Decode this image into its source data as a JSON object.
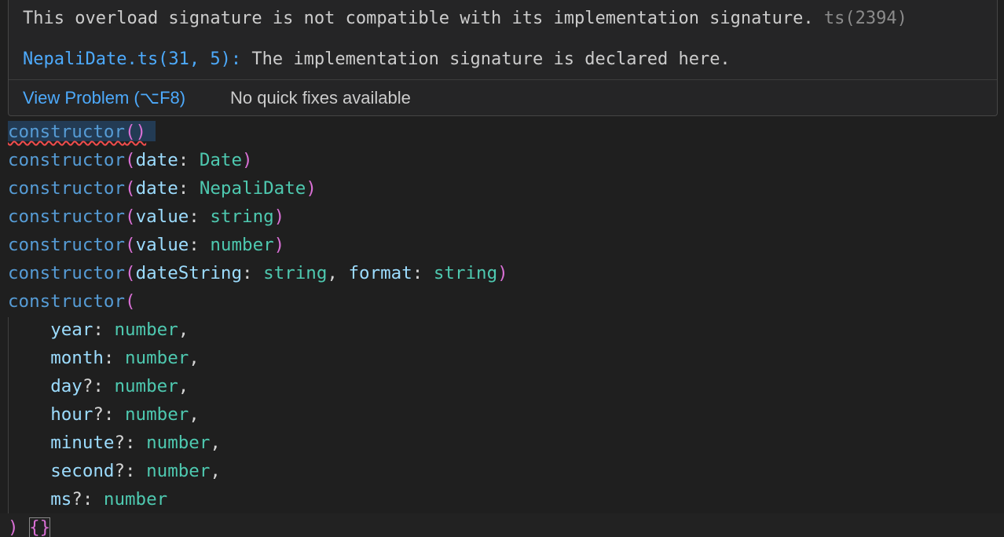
{
  "hover": {
    "message": "This overload signature is not compatible with its implementation signature.",
    "code": "ts(2394)",
    "related_link": "NepaliDate.ts(31, 5):",
    "related_text": "The implementation signature is declared here.",
    "view_problem": "View Problem (⌥F8)",
    "no_fixes": "No quick fixes available"
  },
  "code": {
    "keyword": "constructor",
    "lines": [
      {
        "params": "()",
        "error": true
      },
      {
        "param1": "date",
        "type1": "Date"
      },
      {
        "param1": "date",
        "type1": "NepaliDate"
      },
      {
        "param1": "value",
        "type1": "string"
      },
      {
        "param1": "value",
        "type1": "number"
      },
      {
        "param1": "dateString",
        "type1": "string",
        "param2": "format",
        "type2": "string"
      }
    ],
    "multiline_params": [
      {
        "name": "year",
        "optional": "",
        "type": "number",
        "comma": ","
      },
      {
        "name": "month",
        "optional": "",
        "type": "number",
        "comma": ","
      },
      {
        "name": "day",
        "optional": "?",
        "type": "number",
        "comma": ","
      },
      {
        "name": "hour",
        "optional": "?",
        "type": "number",
        "comma": ","
      },
      {
        "name": "minute",
        "optional": "?",
        "type": "number",
        "comma": ","
      },
      {
        "name": "second",
        "optional": "?",
        "type": "number",
        "comma": ","
      },
      {
        "name": "ms",
        "optional": "?",
        "type": "number",
        "comma": ""
      }
    ],
    "open_paren": "(",
    "close_paren": ")",
    "body": "{}"
  }
}
